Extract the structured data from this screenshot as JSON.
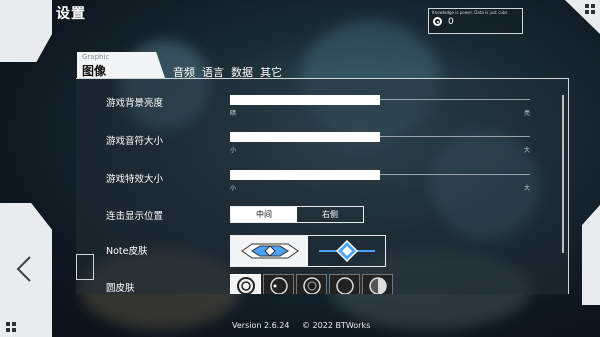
{
  "title": "设置",
  "top_panel": {
    "small_text": "Knowledge is power. Data is just cubs",
    "value": "0"
  },
  "tabs": {
    "active_sub": "Graphic",
    "active": "图像",
    "others": [
      "音频",
      "语言",
      "数据",
      "其它"
    ]
  },
  "settings": {
    "bg_brightness": {
      "label": "游戏背景亮度",
      "min": "暗",
      "max": "亮",
      "value": 0.5
    },
    "note_size": {
      "label": "游戏音符大小",
      "min": "小",
      "max": "大",
      "value": 0.5
    },
    "effect_size": {
      "label": "游戏特效大小",
      "min": "小",
      "max": "大",
      "value": 0.5
    },
    "combo_pos": {
      "label": "连击显示位置",
      "options": [
        "中间",
        "右侧"
      ],
      "selected": "中间"
    },
    "note_skin": {
      "label": "Note皮肤"
    },
    "circle_skin": {
      "label": "圆皮肤"
    }
  },
  "footer": {
    "version": "Version 2.6.24",
    "copyright": "© 2022 BTWorks"
  },
  "colors": {
    "panel_border": "#d0d5d8",
    "accent_blue": "#4aa3ff",
    "tab_bg": "#f2f4f5"
  }
}
